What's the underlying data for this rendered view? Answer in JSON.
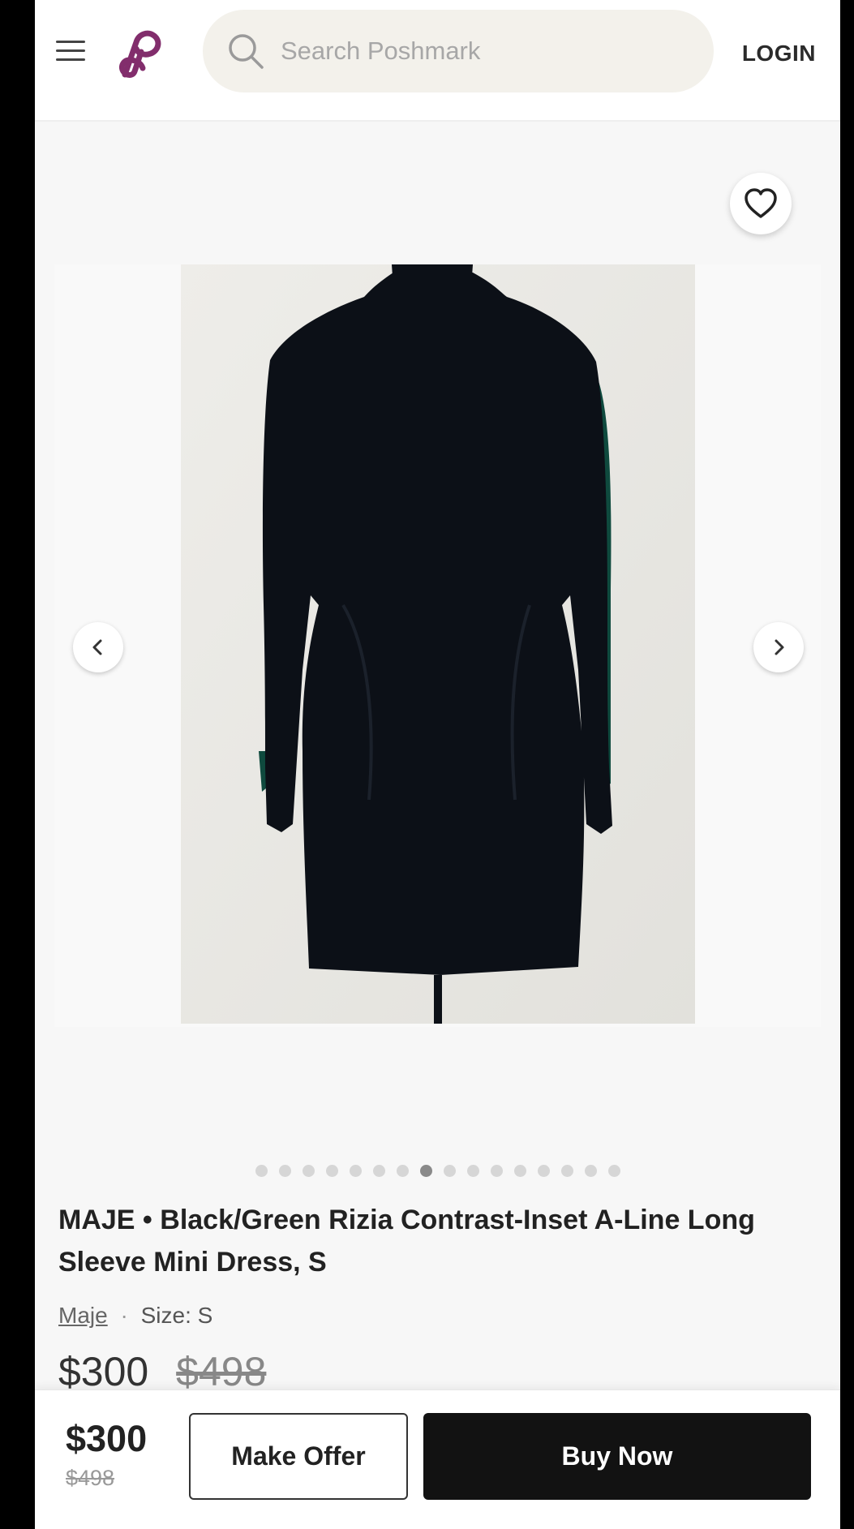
{
  "header": {
    "search_placeholder": "Search Poshmark",
    "login_label": "LOGIN",
    "brand_color": "#822d6c"
  },
  "gallery": {
    "image_count": 16,
    "active_index": 7
  },
  "listing": {
    "title": "MAJE • Black/Green Rizia Contrast-Inset A-Line Long Sleeve Mini Dress, S",
    "brand": "Maje",
    "separator": "·",
    "size": "Size: S",
    "price": "$300",
    "original_price": "$498"
  },
  "bottom_bar": {
    "price": "$300",
    "original_price": "$498",
    "make_offer_label": "Make Offer",
    "buy_now_label": "Buy Now"
  },
  "icons": [
    "menu-icon",
    "poshmark-logo",
    "search-icon",
    "heart-icon",
    "chevron-left-icon",
    "chevron-right-icon"
  ]
}
